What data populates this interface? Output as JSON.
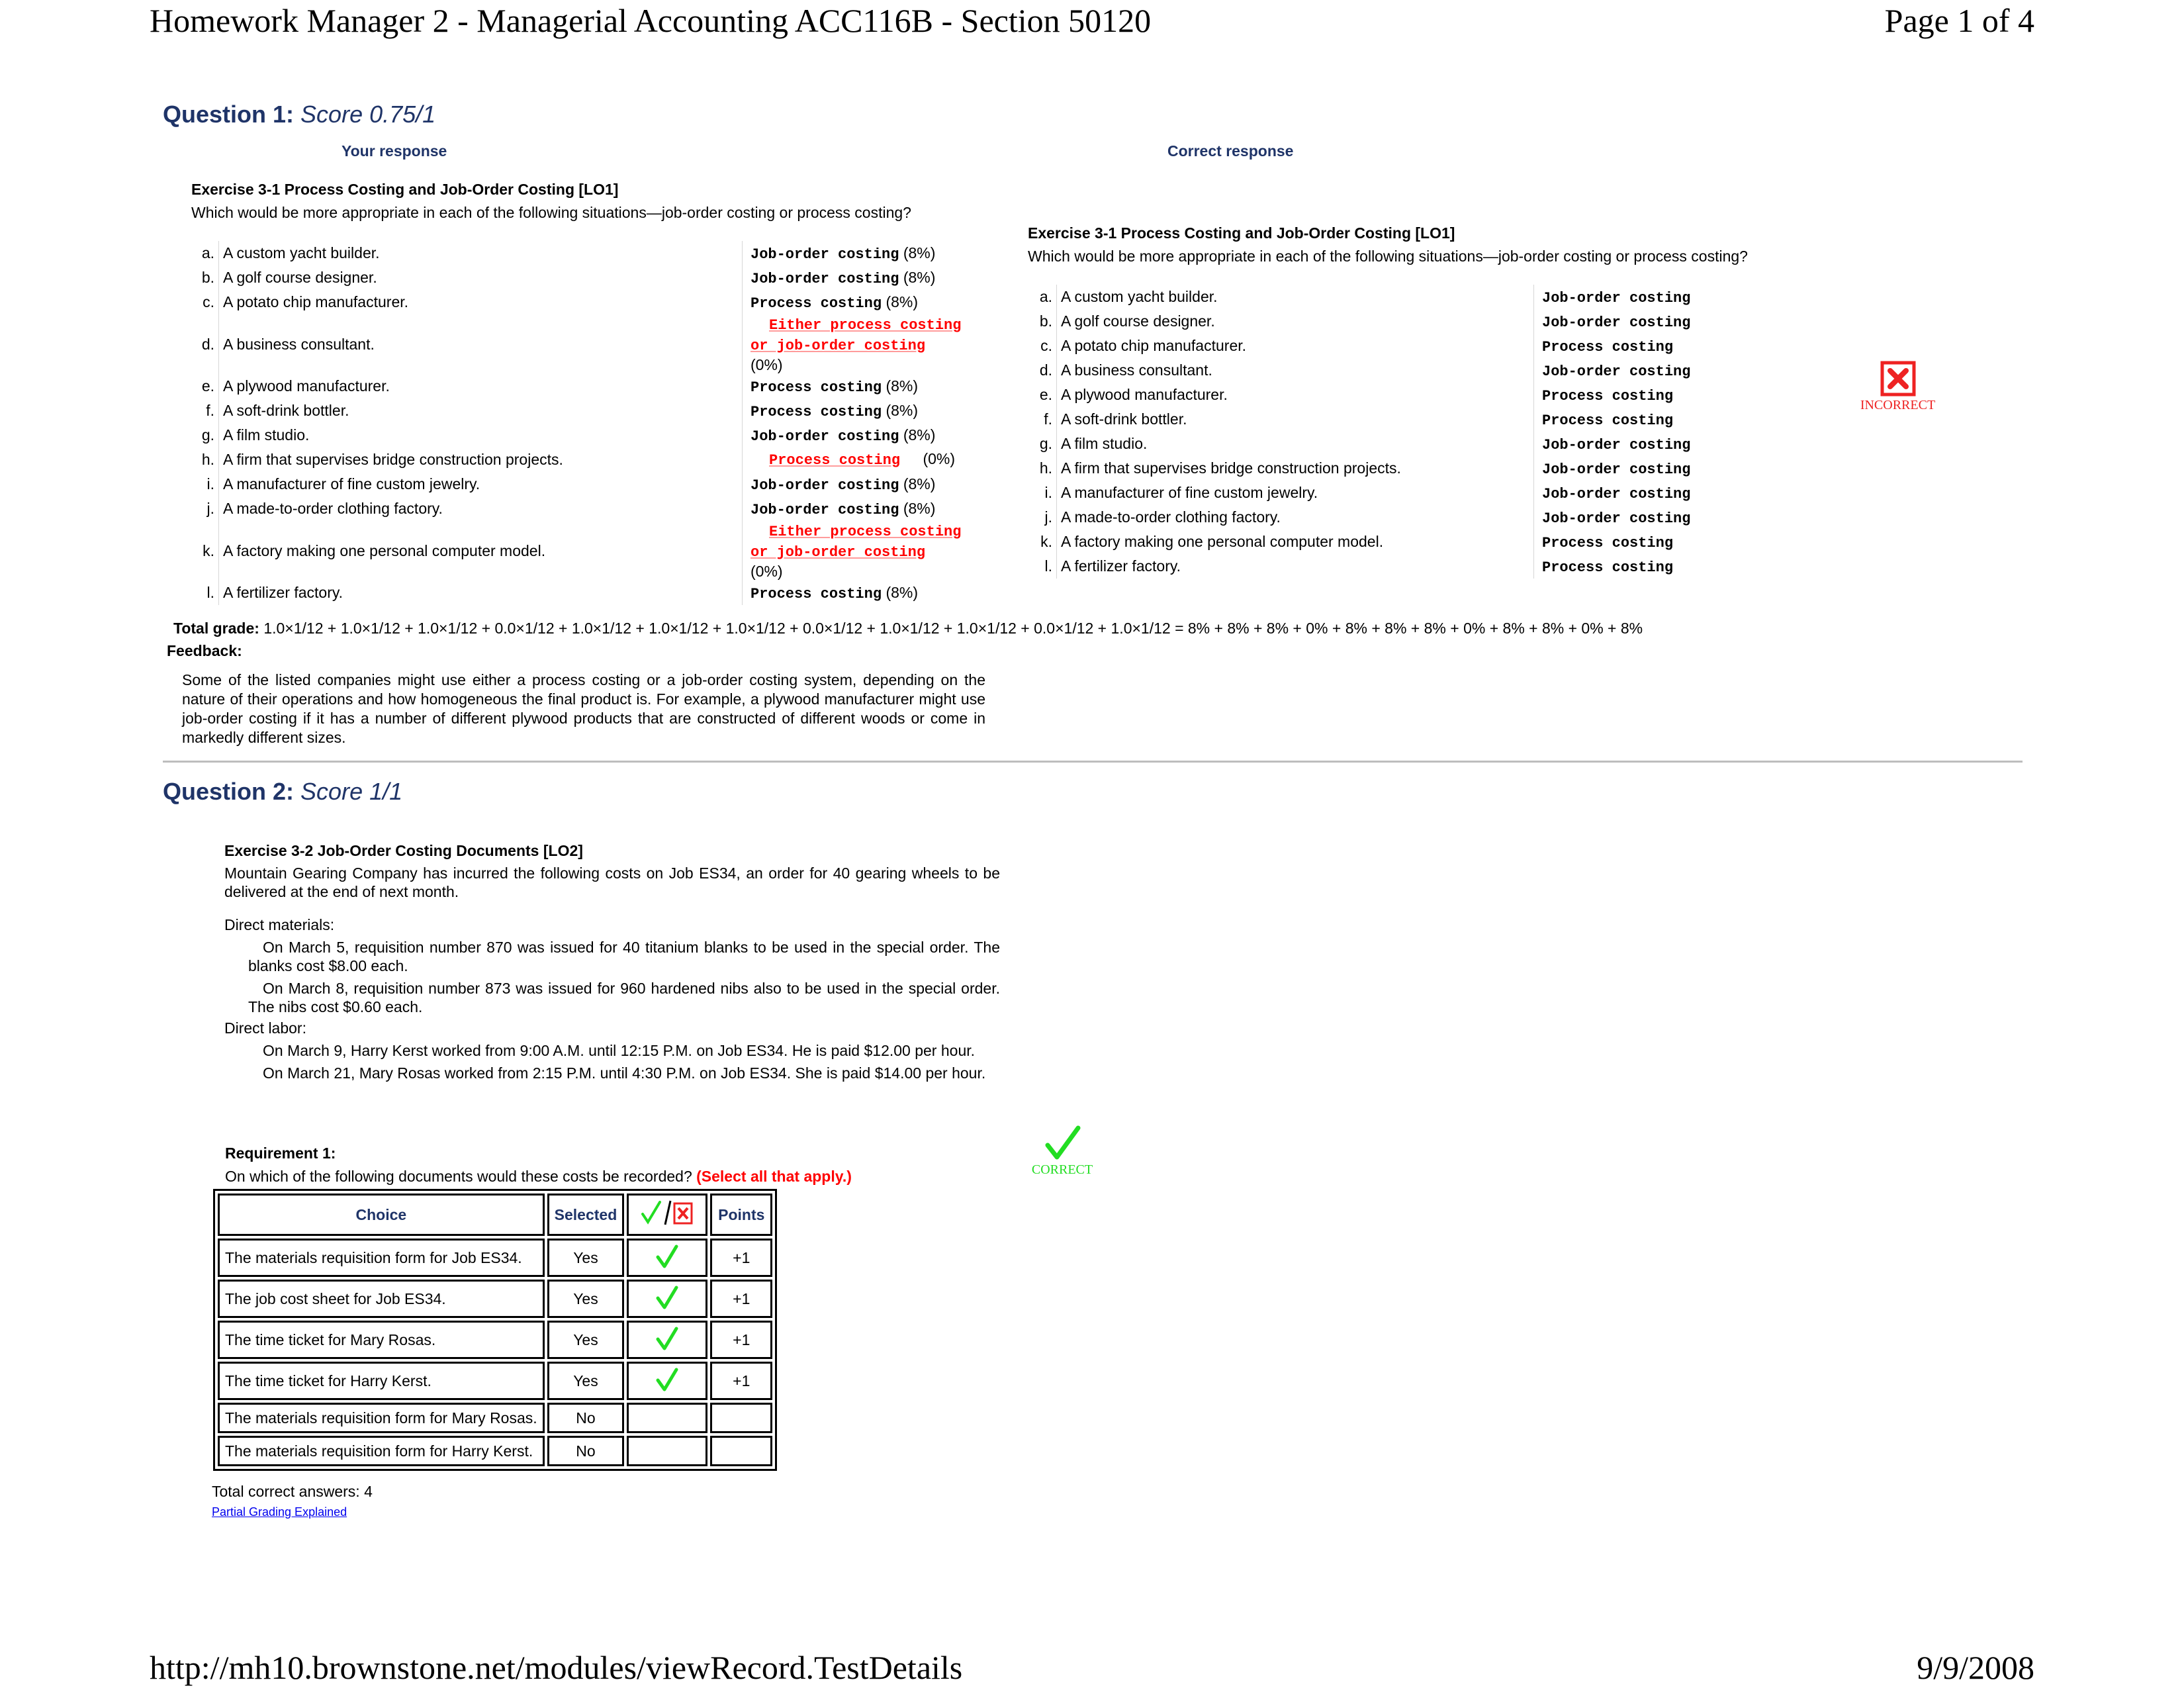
{
  "header": {
    "title": "Homework Manager 2 - Managerial Accounting ACC116B - Section 50120",
    "page": "Page 1 of 4"
  },
  "footer": {
    "url": "http://mh10.brownstone.net/modules/viewRecord.TestDetails",
    "date": "9/9/2008"
  },
  "question1": {
    "label": "Question 1:",
    "score": "Score 0.75/1",
    "your_response_label": "Your response",
    "correct_response_label": "Correct response",
    "exercise_title": "Exercise 3-1 Process Costing and Job-Order Costing [LO1]",
    "prompt": "Which would be more appropriate in each of the following situations—job-order costing or process costing?",
    "your_rows": [
      {
        "letter": "a.",
        "desc": "A custom yacht builder.",
        "answer": "Job-order costing",
        "pct": "(8%)",
        "correct": true
      },
      {
        "letter": "b.",
        "desc": "A golf course designer.",
        "answer": "Job-order costing",
        "pct": "(8%)",
        "correct": true
      },
      {
        "letter": "c.",
        "desc": "A potato chip manufacturer.",
        "answer": "Process costing",
        "pct": "(8%)",
        "correct": true
      },
      {
        "letter": "d.",
        "desc": "A business consultant.",
        "answer": "Either process costing or job-order costing",
        "pct": "(0%)",
        "correct": false
      },
      {
        "letter": "e.",
        "desc": "A plywood manufacturer.",
        "answer": "Process costing",
        "pct": "(8%)",
        "correct": true
      },
      {
        "letter": "f.",
        "desc": "A soft-drink bottler.",
        "answer": "Process costing",
        "pct": "(8%)",
        "correct": true
      },
      {
        "letter": "g.",
        "desc": "A film studio.",
        "answer": "Job-order costing",
        "pct": "(8%)",
        "correct": true
      },
      {
        "letter": "h.",
        "desc": "A firm that supervises bridge construction projects.",
        "answer": "Process costing",
        "pct": "(0%)",
        "correct": false
      },
      {
        "letter": "i.",
        "desc": "A manufacturer of fine custom jewelry.",
        "answer": "Job-order costing",
        "pct": "(8%)",
        "correct": true
      },
      {
        "letter": "j.",
        "desc": "A made-to-order clothing factory.",
        "answer": "Job-order costing",
        "pct": "(8%)",
        "correct": true
      },
      {
        "letter": "k.",
        "desc": "A factory making one personal computer model.",
        "answer": "Either process costing or job-order costing",
        "pct": "(0%)",
        "correct": false
      },
      {
        "letter": "l.",
        "desc": "A fertilizer factory.",
        "answer": "Process costing",
        "pct": "(8%)",
        "correct": true
      }
    ],
    "correct_rows": [
      {
        "letter": "a.",
        "desc": "A custom yacht builder.",
        "answer": "Job-order costing"
      },
      {
        "letter": "b.",
        "desc": "A golf course designer.",
        "answer": "Job-order costing"
      },
      {
        "letter": "c.",
        "desc": "A potato chip manufacturer.",
        "answer": "Process costing"
      },
      {
        "letter": "d.",
        "desc": "A business consultant.",
        "answer": "Job-order costing"
      },
      {
        "letter": "e.",
        "desc": "A plywood manufacturer.",
        "answer": "Process costing"
      },
      {
        "letter": "f.",
        "desc": "A soft-drink bottler.",
        "answer": "Process costing"
      },
      {
        "letter": "g.",
        "desc": "A film studio.",
        "answer": "Job-order costing"
      },
      {
        "letter": "h.",
        "desc": "A firm that supervises bridge construction projects.",
        "answer": "Job-order costing"
      },
      {
        "letter": "i.",
        "desc": "A manufacturer of fine custom jewelry.",
        "answer": "Job-order costing"
      },
      {
        "letter": "j.",
        "desc": "A made-to-order clothing factory.",
        "answer": "Job-order costing"
      },
      {
        "letter": "k.",
        "desc": "A factory making one personal computer model.",
        "answer": "Process costing"
      },
      {
        "letter": "l.",
        "desc": "A fertilizer factory.",
        "answer": "Process costing"
      }
    ],
    "status_icon": "incorrect-icon",
    "status_label": "INCORRECT",
    "total_grade_label": "Total grade:",
    "total_grade_formula": "1.0×1/12 + 1.0×1/12 + 1.0×1/12 + 0.0×1/12 + 1.0×1/12 + 1.0×1/12 + 1.0×1/12 + 0.0×1/12 + 1.0×1/12 + 1.0×1/12 + 0.0×1/12 + 1.0×1/12 = 8% + 8% + 8% + 0% + 8% + 8% + 8% + 0% + 8% + 8% + 0% + 8%",
    "feedback_label": "Feedback:",
    "feedback_text": "Some of the listed companies might use either a process costing or a job-order costing system, depending on the nature of their operations and how homogeneous the final product is. For example, a plywood manufacturer might use job-order costing if it has a number of different plywood products that are constructed of different woods or come in markedly different sizes."
  },
  "question2": {
    "label": "Question 2:",
    "score": "Score 1/1",
    "exercise_title": "Exercise 3-2 Job-Order Costing Documents [LO2]",
    "intro": "Mountain Gearing Company has incurred the following costs on Job ES34, an order for 40 gearing wheels to be delivered at the end of next month.",
    "direct_materials_label": "Direct materials:",
    "direct_materials": [
      "On March 5, requisition number 870 was issued for 40 titanium blanks to be used in the special order. The blanks cost $8.00 each.",
      "On March 8, requisition number 873 was issued for 960 hardened nibs also to be used in the special order. The nibs cost $0.60 each."
    ],
    "direct_labor_label": "Direct labor:",
    "direct_labor": [
      "On March 9, Harry Kerst worked from 9:00 A.M. until 12:15 P.M. on Job ES34. He is paid $12.00 per hour.",
      "On March 21, Mary Rosas worked from 2:15 P.M. until 4:30 P.M. on Job ES34. She is paid $14.00 per hour."
    ],
    "requirement_label": "Requirement 1:",
    "requirement_prompt": "On which of the following documents would these costs be recorded?",
    "requirement_hint": "(Select all that apply.)",
    "status_icon": "correct-icon",
    "status_label": "CORRECT",
    "table": {
      "headers": [
        "Choice",
        "Selected",
        "check-or-x-icon",
        "Points"
      ],
      "rows": [
        {
          "choice": "The materials requisition form for Job ES34.",
          "selected": "Yes",
          "mark": "check",
          "points": "+1"
        },
        {
          "choice": "The job cost sheet for Job ES34.",
          "selected": "Yes",
          "mark": "check",
          "points": "+1"
        },
        {
          "choice": "The time ticket for Mary Rosas.",
          "selected": "Yes",
          "mark": "check",
          "points": "+1"
        },
        {
          "choice": "The time ticket for Harry Kerst.",
          "selected": "Yes",
          "mark": "check",
          "points": "+1"
        },
        {
          "choice": "The materials requisition form for Mary Rosas.",
          "selected": "No",
          "mark": "",
          "points": ""
        },
        {
          "choice": "The materials requisition form for Harry Kerst.",
          "selected": "No",
          "mark": "",
          "points": ""
        }
      ]
    },
    "total_correct": "Total correct answers: 4",
    "partial_grading_link": "Partial Grading Explained"
  },
  "colors": {
    "heading": "#1f3468",
    "wrong_answer": "#ff0000",
    "correct_mark": "#22dd22",
    "incorrect_mark": "#ee2222",
    "link": "#0000ee"
  }
}
